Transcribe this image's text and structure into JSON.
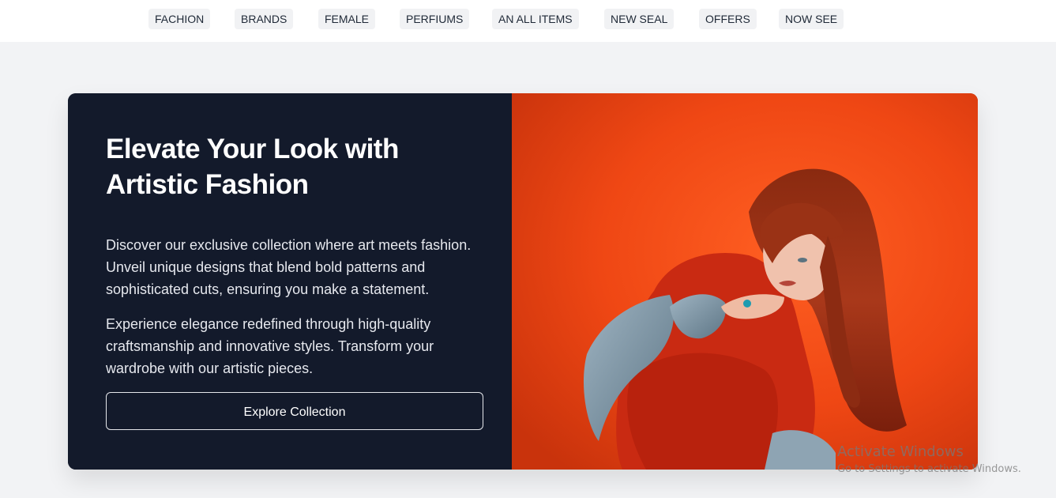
{
  "nav": {
    "items": [
      {
        "label": "FACHION"
      },
      {
        "label": "BRANDS"
      },
      {
        "label": "FEMALE"
      },
      {
        "label": "PERFIUMS"
      },
      {
        "label": "AN ALL ITEMS"
      },
      {
        "label": "NEW SEAL"
      },
      {
        "label": "OFFERS"
      },
      {
        "label": "NOW SEE"
      }
    ]
  },
  "hero": {
    "title": "Elevate Your Look with Artistic Fashion",
    "paragraph1": "Discover our exclusive collection where art meets fashion. Unveil unique designs that blend bold patterns and sophisticated cuts, ensuring you make a statement.",
    "paragraph2": "Experience elegance redefined through high-quality craftsmanship and innovative styles. Transform your wardrobe with our artistic pieces.",
    "cta_label": "Explore Collection",
    "image_alt": "Woman with long red hair in a red outfit and denim jacket crouching against an orange background"
  },
  "watermark": {
    "title": "Activate Windows",
    "subtitle": "Go to Settings to activate Windows."
  },
  "colors": {
    "page_bg": "#f2f3f5",
    "hero_panel": "#131a2b",
    "photo_bg": "#f24b16",
    "nav_pill": "#f1f2f4"
  }
}
